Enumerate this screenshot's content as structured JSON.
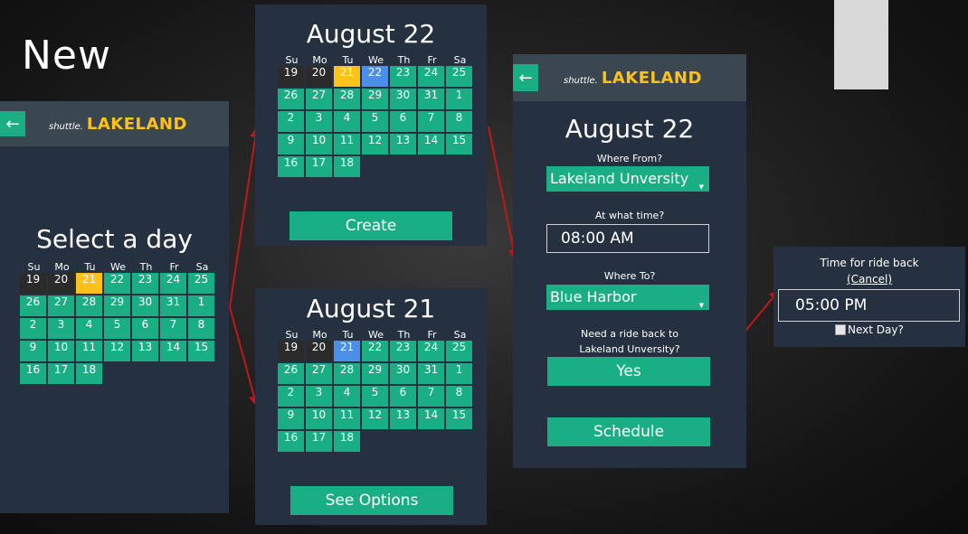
{
  "slide": {
    "title": "New"
  },
  "brand": {
    "small": "shuttle.",
    "big": "LAKELAND"
  },
  "icons": {
    "back": "back-arrow-icon",
    "dropdown": "caret-down-icon",
    "checkbox": "checkbox-icon"
  },
  "colors": {
    "green": "#1aae84",
    "panel": "#253140",
    "appbar": "#3a4650",
    "accent_yellow": "#ffc21a",
    "accent_blue": "#4b8fe8"
  },
  "weekdays": [
    "Su",
    "Mo",
    "Tu",
    "We",
    "Th",
    "Fr",
    "Sa"
  ],
  "calendar_rows": [
    [
      "19",
      "20",
      "21",
      "22",
      "23",
      "24",
      "25"
    ],
    [
      "26",
      "27",
      "28",
      "29",
      "30",
      "31",
      "1"
    ],
    [
      "2",
      "3",
      "4",
      "5",
      "6",
      "7",
      "8"
    ],
    [
      "9",
      "10",
      "11",
      "12",
      "13",
      "14",
      "15"
    ],
    [
      "16",
      "17",
      "18"
    ]
  ],
  "screen1": {
    "heading": "Select a day",
    "selected_day": "21"
  },
  "screen2": {
    "heading": "August 22",
    "today": "21",
    "selected_day": "22",
    "button": "Create"
  },
  "screen3": {
    "heading": "August 21",
    "selected_day": "21",
    "button": "See Options"
  },
  "screen4": {
    "heading": "August 22",
    "from_label": "Where From?",
    "from_value": "Lakeland Unversity",
    "time_label": "At what time?",
    "time_value": "08:00 AM",
    "to_label": "Where To?",
    "to_value": "Blue Harbor",
    "return_q1": "Need a ride back to",
    "return_q2": "Lakeland Unversity?",
    "yes_button": "Yes",
    "schedule_button": "Schedule"
  },
  "popup": {
    "title": "Time for ride back",
    "cancel": "(Cancel)",
    "time_value": "05:00 PM",
    "next_day": "Next Day?"
  }
}
